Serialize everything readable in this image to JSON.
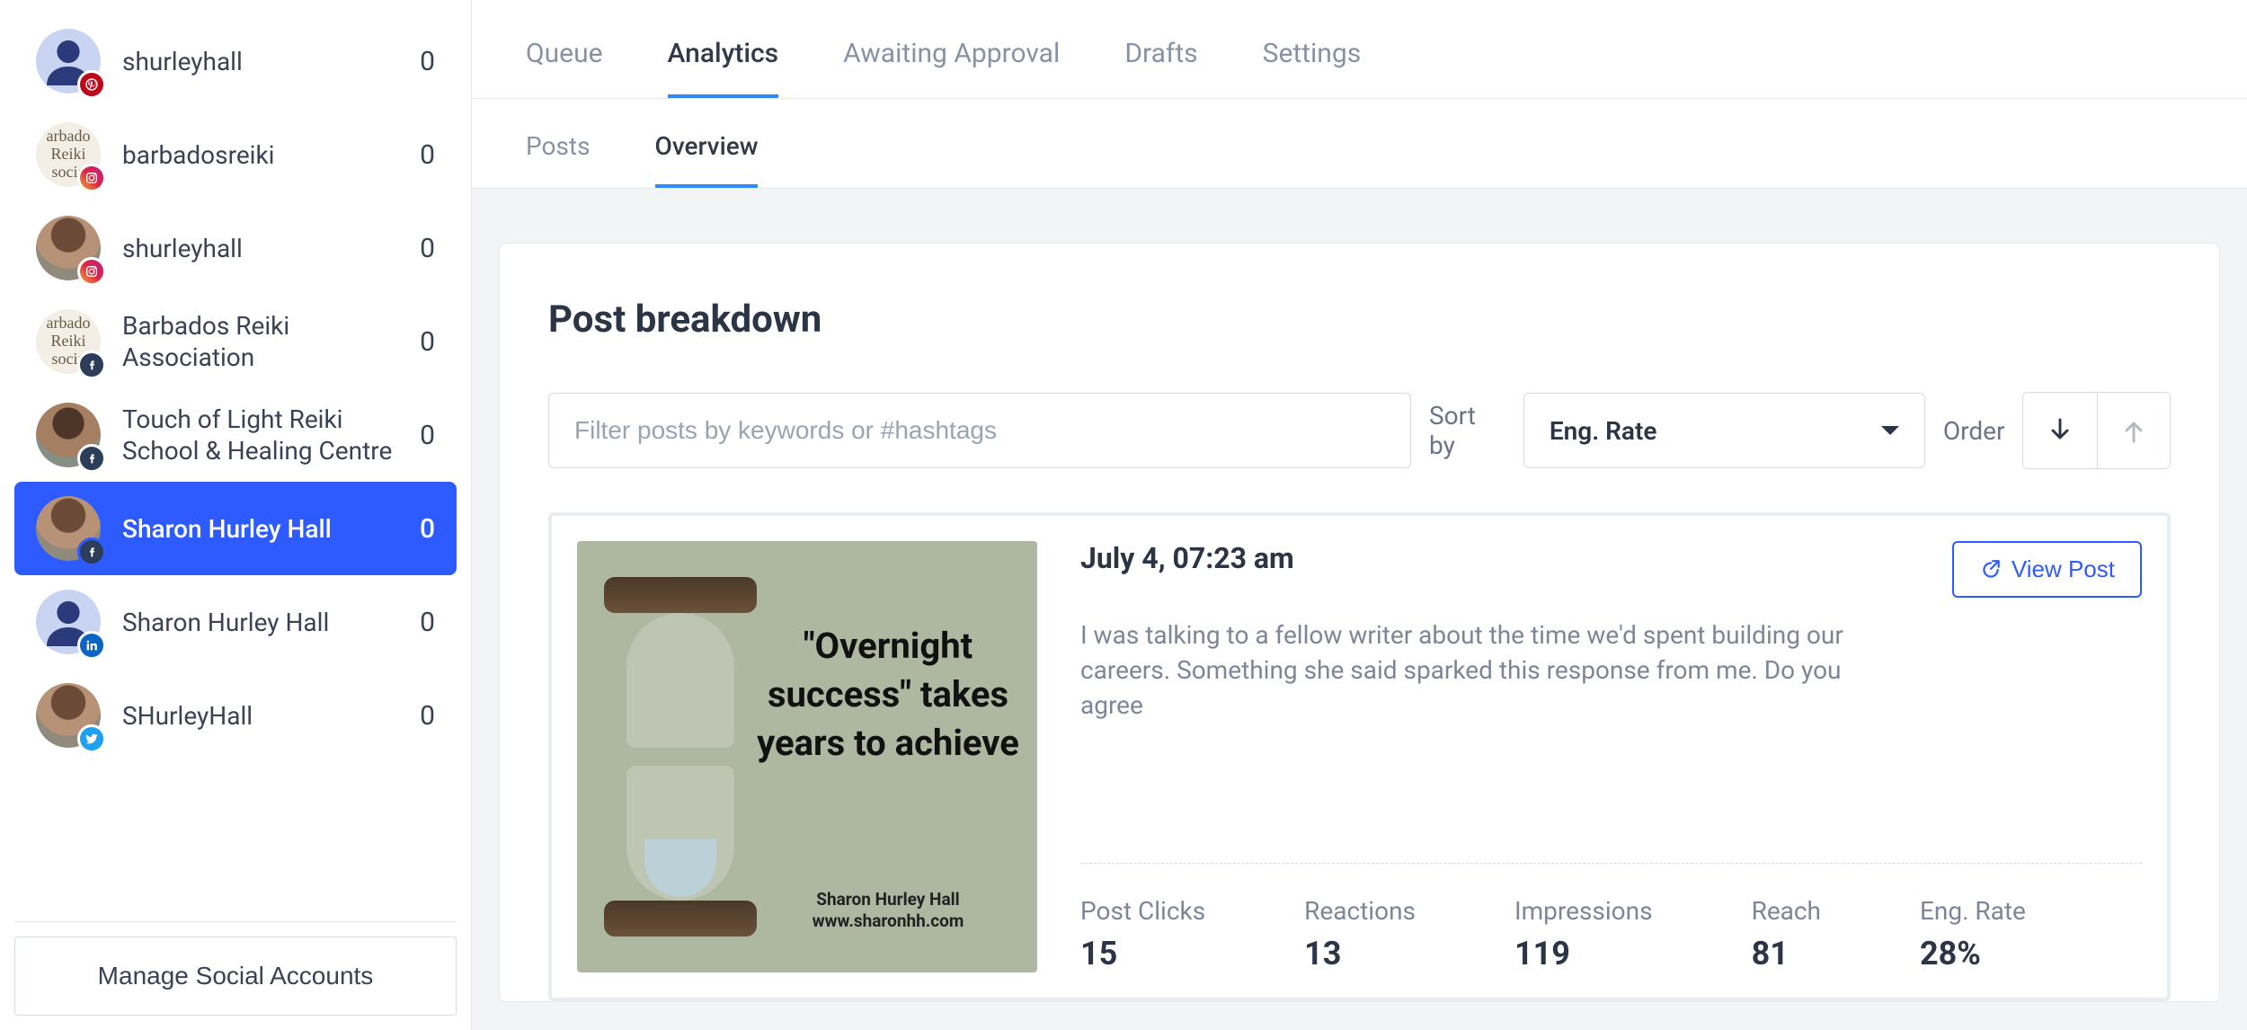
{
  "sidebar": {
    "accounts": [
      {
        "label": "shurleyhall",
        "count": 0,
        "network": "pinterest",
        "avatar": "silhouette"
      },
      {
        "label": "barbadosreiki",
        "count": 0,
        "network": "instagram",
        "avatar": "reiki"
      },
      {
        "label": "shurleyhall",
        "count": 0,
        "network": "instagram",
        "avatar": "photo1"
      },
      {
        "label": "Barbados Reiki Association",
        "count": 0,
        "network": "facebook",
        "avatar": "reiki"
      },
      {
        "label": "Touch of Light Reiki School & Healing Centre",
        "count": 0,
        "network": "facebook",
        "avatar": "photo2"
      },
      {
        "label": "Sharon Hurley Hall",
        "count": 0,
        "network": "facebook",
        "avatar": "photo1",
        "active": true
      },
      {
        "label": "Sharon Hurley Hall",
        "count": 0,
        "network": "linkedin",
        "avatar": "silhouette"
      },
      {
        "label": "SHurleyHall",
        "count": 0,
        "network": "twitter",
        "avatar": "photo1"
      }
    ],
    "manage_label": "Manage Social Accounts"
  },
  "tabs": {
    "primary": [
      "Queue",
      "Analytics",
      "Awaiting Approval",
      "Drafts",
      "Settings"
    ],
    "primary_active": 1,
    "secondary": [
      "Posts",
      "Overview"
    ],
    "secondary_active": 1
  },
  "panel": {
    "title": "Post breakdown",
    "filter_placeholder": "Filter posts by keywords or #hashtags",
    "sort_by_label": "Sort by",
    "sort_value": "Eng. Rate",
    "order_label": "Order"
  },
  "post": {
    "date": "July 4, 07:23 am",
    "view_label": "View Post",
    "text": "I was talking to a fellow writer about the time we'd spent building our careers. Something she said sparked this response from me. Do you agree",
    "thumb_quote": "\"Overnight success\" takes years to achieve",
    "thumb_attrib_name": "Sharon Hurley Hall",
    "thumb_attrib_url": "www.sharonhh.com",
    "metrics": [
      {
        "label": "Post Clicks",
        "value": "15"
      },
      {
        "label": "Reactions",
        "value": "13"
      },
      {
        "label": "Impressions",
        "value": "119"
      },
      {
        "label": "Reach",
        "value": "81"
      },
      {
        "label": "Eng. Rate",
        "value": "28%"
      }
    ]
  }
}
